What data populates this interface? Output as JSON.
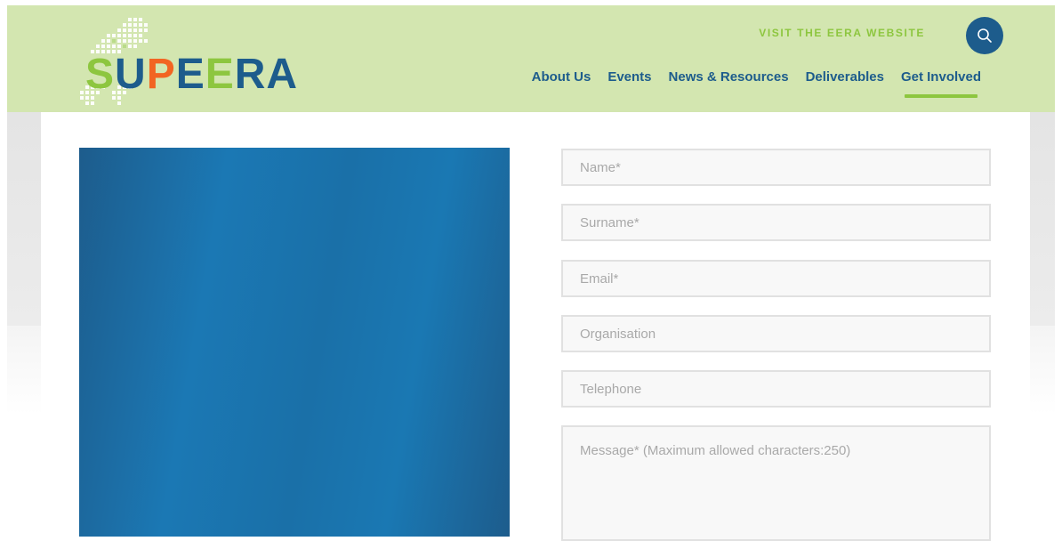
{
  "brand": {
    "logo_letters": [
      "S",
      "U",
      "P",
      "E",
      "E",
      "R",
      "A"
    ],
    "logo_colors": [
      "#8dc63f",
      "#1d5c8c",
      "#f26522",
      "#1d5c8c",
      "#8dc63f",
      "#1d5c8c",
      "#1d5c8c"
    ],
    "accent": "#8dc63f",
    "primary": "#1d5c8c",
    "header_bg": "#d3e6b0"
  },
  "header": {
    "visit_link": "VISIT THE EERA WEBSITE",
    "search_icon": "search-icon"
  },
  "nav": {
    "items": [
      {
        "label": "About Us",
        "active": false
      },
      {
        "label": "Events",
        "active": false
      },
      {
        "label": "News & Resources",
        "active": false
      },
      {
        "label": "Deliverables",
        "active": false
      },
      {
        "label": "Get Involved",
        "active": true
      }
    ]
  },
  "form": {
    "name_placeholder": "Name*",
    "surname_placeholder": "Surname*",
    "email_placeholder": "Email*",
    "organisation_placeholder": "Organisation",
    "telephone_placeholder": "Telephone",
    "message_placeholder": "Message* (Maximum allowed characters:250)"
  }
}
